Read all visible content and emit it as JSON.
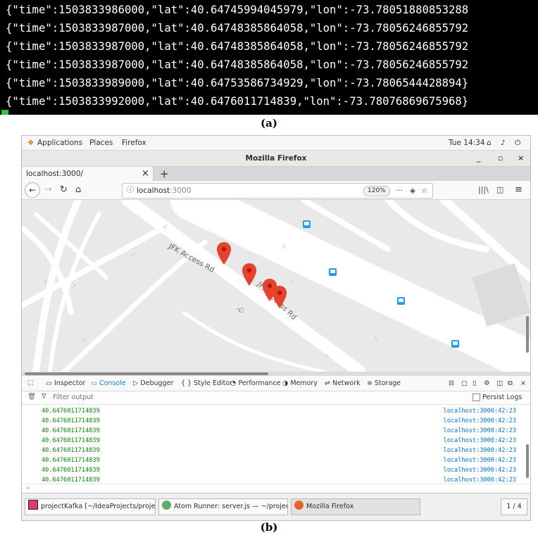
{
  "terminal": {
    "lines": [
      "{\"time\":1503833986000,\"lat\":40.64745994045979,\"lon\":-73.78051880853288",
      "{\"time\":1503833987000,\"lat\":40.64748385864058,\"lon\":-73.78056246855792",
      "{\"time\":1503833987000,\"lat\":40.64748385864058,\"lon\":-73.78056246855792",
      "{\"time\":1503833987000,\"lat\":40.64748385864058,\"lon\":-73.78056246855792",
      "{\"time\":1503833989000,\"lat\":40.64753586734929,\"lon\":-73.7806544428894}",
      "{\"time\":1503833992000,\"lat\":40.6476011714839,\"lon\":-73.78076869675968}"
    ]
  },
  "captions": {
    "a": "(a)",
    "b": "(b)"
  },
  "gnome": {
    "applications": "Applications",
    "places": "Places",
    "firefox": "Firefox",
    "clock": "Tue 14:34"
  },
  "window": {
    "title": "Mozilla Firefox",
    "minimize": "_",
    "maximize": "▫",
    "close": "×"
  },
  "tabs": {
    "current_label": "localhost:3000/",
    "close": "×",
    "new_tab": "+"
  },
  "nav": {
    "url_host": "localhost",
    "url_port": ":3000",
    "zoom": "120%",
    "more": "···"
  },
  "map": {
    "road_labels": [
      "JFK Access Rd",
      "JFK Access Rd"
    ],
    "marker_color": "#e8412c",
    "bus_icon_color": "#1aa3e8"
  },
  "devtools": {
    "tabs": [
      "Inspector",
      "Console",
      "Debugger",
      "{ } Style Editor",
      "Performance",
      "Memory",
      "Network",
      "Storage"
    ],
    "active_tab": "Console",
    "filter_placeholder": "Filter output",
    "persist_logs": "Persist Logs",
    "logs": [
      {
        "value": "40.6476011714839",
        "source": "localhost:3000:42:23"
      },
      {
        "value": "40.6476011714839",
        "source": "localhost:3000:42:23"
      },
      {
        "value": "40.6476011714839",
        "source": "localhost:3000:42:23"
      },
      {
        "value": "40.6476011714839",
        "source": "localhost:3000:42:23"
      },
      {
        "value": "40.6476011714839",
        "source": "localhost:3000:42:23"
      },
      {
        "value": "40.6476011714839",
        "source": "localhost:3000:42:23"
      },
      {
        "value": "40.6476011714839",
        "source": "localhost:3000:42:23"
      },
      {
        "value": "40.6476011714839",
        "source": "localhost:3000:42:23"
      }
    ],
    "prompt": "»"
  },
  "taskbar": {
    "items": [
      "projectKafka [~/IdeaProjects/project...",
      "Atom Runner: server.js — ~/project...",
      "Mozilla Firefox"
    ],
    "workspace": "1 / 4"
  }
}
